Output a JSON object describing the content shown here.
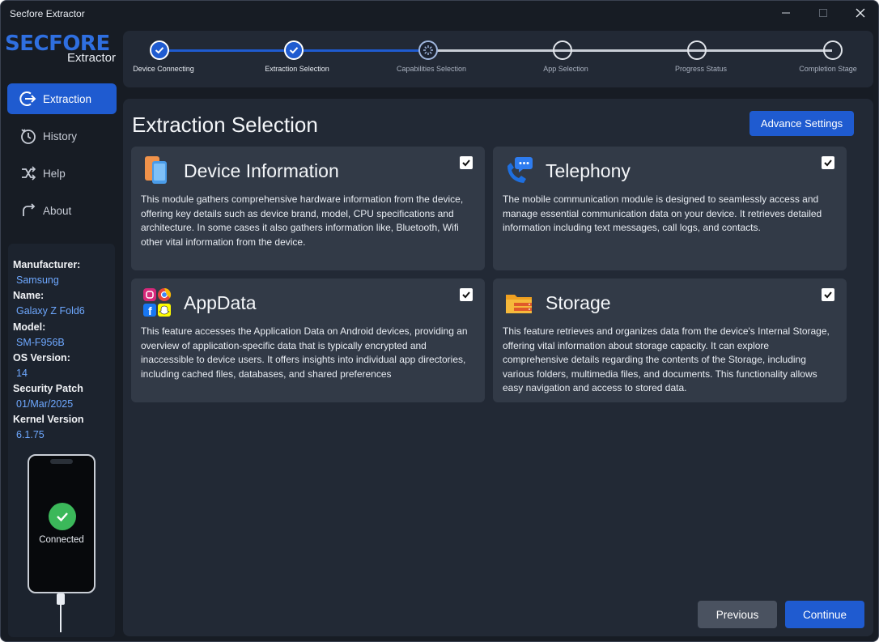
{
  "window": {
    "title": "Secfore Extractor"
  },
  "logo": {
    "brand": "SECFORE",
    "sub": "Extractor"
  },
  "sidebar": {
    "items": [
      {
        "label": "Extraction",
        "icon": "arrow-right-circle-icon",
        "active": true
      },
      {
        "label": "History",
        "icon": "history-clock-icon",
        "active": false
      },
      {
        "label": "Help",
        "icon": "shuffle-icon",
        "active": false
      },
      {
        "label": "About",
        "icon": "redo-arrow-icon",
        "active": false
      }
    ]
  },
  "device": {
    "manufacturer_label": "Manufacturer:",
    "manufacturer": "Samsung",
    "name_label": "Name:",
    "name": "Galaxy Z Fold6",
    "model_label": "Model:",
    "model": "SM-F956B",
    "os_label": "OS Version:",
    "os": "14",
    "patch_label": "Security Patch",
    "patch": "01/Mar/2025",
    "kernel_label": "Kernel Version",
    "kernel": "6.1.75",
    "status": "Connected"
  },
  "stepper": {
    "steps": [
      {
        "label": "Device Connecting",
        "state": "done"
      },
      {
        "label": "Extraction Selection",
        "state": "done"
      },
      {
        "label": "Capabilities Selection",
        "state": "current"
      },
      {
        "label": "App Selection",
        "state": "pending"
      },
      {
        "label": "Progress Status",
        "state": "pending"
      },
      {
        "label": "Completion Stage",
        "state": "pending"
      }
    ]
  },
  "main": {
    "title": "Extraction Selection",
    "advance_settings": "Advance Settings",
    "cards": [
      {
        "title": "Device Information",
        "icon": "device-information-icon",
        "checked": true,
        "desc": "This module gathers comprehensive hardware information from the device, offering key details such as device brand, model, CPU specifications and architecture. In some cases it also gathers information like, Bluetooth, Wifi  other vital information from the device."
      },
      {
        "title": "Telephony",
        "icon": "telephony-chat-icon",
        "checked": true,
        "desc": "The mobile communication module is designed to seamlessly access and manage essential communication data on your device. It retrieves detailed information including text messages, call logs, and contacts."
      },
      {
        "title": "AppData",
        "icon": "app-grid-icon",
        "checked": true,
        "desc": "This feature accesses the Application Data on Android devices, providing an overview of application-specific data that is typically encrypted and inaccessible to device users. It offers insights into individual app directories, including cached files, databases, and shared preferences"
      },
      {
        "title": "Storage",
        "icon": "folder-storage-icon",
        "checked": true,
        "desc": "This feature retrieves and organizes data from the device's Internal Storage, offering vital information about storage capacity. It can explore comprehensive details regarding the contents of the Storage, including various folders, multimedia files, and documents. This functionality allows easy navigation and access to stored data."
      }
    ],
    "previous": "Previous",
    "continue": "Continue"
  },
  "colors": {
    "accent": "#1f5bd0",
    "bg": "#171c24",
    "panel": "#222935",
    "card": "#323a47",
    "link": "#6ea8ff",
    "success": "#3bb85a"
  }
}
